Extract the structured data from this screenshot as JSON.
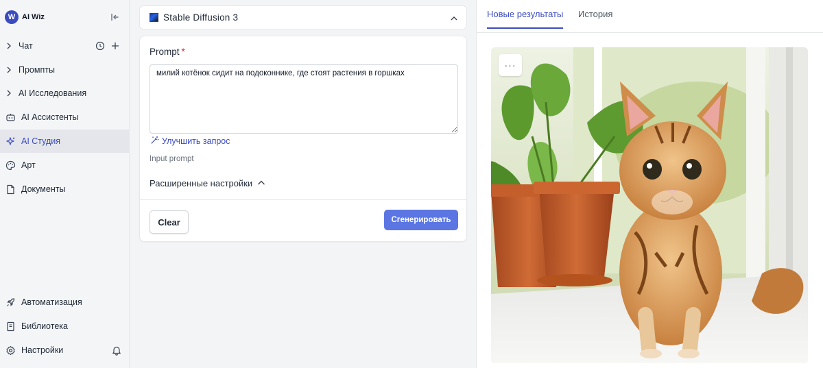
{
  "brand": {
    "logo_letter": "W",
    "name": "AI Wiz"
  },
  "sidebar": {
    "items": [
      {
        "label": "Чат"
      },
      {
        "label": "Промпты"
      },
      {
        "label": "AI Исследования"
      },
      {
        "label": "AI Ассистенты"
      },
      {
        "label": "AI Студия",
        "active": true
      },
      {
        "label": "Арт"
      },
      {
        "label": "Документы"
      }
    ],
    "bottom_items": [
      {
        "label": "Автоматизация"
      },
      {
        "label": "Библиотека"
      },
      {
        "label": "Настройки"
      }
    ]
  },
  "model": {
    "name": "Stable Diffusion 3"
  },
  "form": {
    "prompt_label": "Prompt",
    "required_mark": "*",
    "prompt_value": "милий котёнок сидит на подоконнике, где стоят растения в горшках",
    "improve_label": "Улучшить запрос",
    "helper_text": "Input prompt",
    "advanced_label": "Расширенные настройки",
    "clear_label": "Clear",
    "generate_label": "Сгенерировать"
  },
  "results": {
    "tabs": [
      {
        "label": "Новые результаты",
        "active": true
      },
      {
        "label": "История",
        "active": false
      }
    ],
    "more_label": "···"
  },
  "colors": {
    "accent": "#3b4cc0",
    "button": "#5b76e3",
    "required": "#dc2626"
  }
}
